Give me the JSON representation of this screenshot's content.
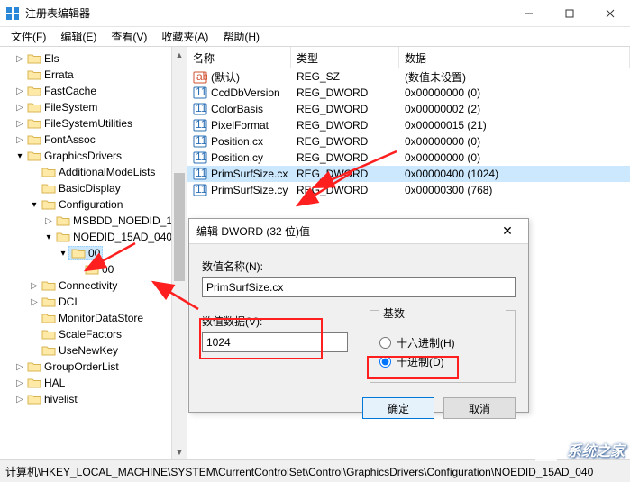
{
  "window": {
    "title": "注册表编辑器"
  },
  "menubar": {
    "file": "文件(F)",
    "edit": "编辑(E)",
    "view": "查看(V)",
    "favorites": "收藏夹(A)",
    "help": "帮助(H)"
  },
  "tree": {
    "items": [
      {
        "indent": 1,
        "caret": "closed",
        "label": "Els"
      },
      {
        "indent": 1,
        "caret": "none",
        "label": "Errata"
      },
      {
        "indent": 1,
        "caret": "closed",
        "label": "FastCache"
      },
      {
        "indent": 1,
        "caret": "closed",
        "label": "FileSystem"
      },
      {
        "indent": 1,
        "caret": "closed",
        "label": "FileSystemUtilities"
      },
      {
        "indent": 1,
        "caret": "closed",
        "label": "FontAssoc"
      },
      {
        "indent": 1,
        "caret": "open",
        "label": "GraphicsDrivers"
      },
      {
        "indent": 2,
        "caret": "none",
        "label": "AdditionalModeLists"
      },
      {
        "indent": 2,
        "caret": "none",
        "label": "BasicDisplay"
      },
      {
        "indent": 2,
        "caret": "open",
        "label": "Configuration"
      },
      {
        "indent": 3,
        "caret": "closed",
        "label": "MSBDD_NOEDID_1"
      },
      {
        "indent": 3,
        "caret": "open",
        "label": "NOEDID_15AD_040"
      },
      {
        "indent": 4,
        "caret": "open",
        "label": "00",
        "selected": true
      },
      {
        "indent": 5,
        "caret": "none",
        "label": "00"
      },
      {
        "indent": 2,
        "caret": "closed",
        "label": "Connectivity"
      },
      {
        "indent": 2,
        "caret": "closed",
        "label": "DCI"
      },
      {
        "indent": 2,
        "caret": "none",
        "label": "MonitorDataStore"
      },
      {
        "indent": 2,
        "caret": "none",
        "label": "ScaleFactors"
      },
      {
        "indent": 2,
        "caret": "none",
        "label": "UseNewKey"
      },
      {
        "indent": 1,
        "caret": "closed",
        "label": "GroupOrderList"
      },
      {
        "indent": 1,
        "caret": "closed",
        "label": "HAL"
      },
      {
        "indent": 1,
        "caret": "closed",
        "label": "hivelist"
      }
    ]
  },
  "list": {
    "headers": {
      "name": "名称",
      "type": "类型",
      "data": "数据"
    },
    "rows": [
      {
        "icon": "string",
        "name": "(默认)",
        "type": "REG_SZ",
        "data": "(数值未设置)"
      },
      {
        "icon": "dword",
        "name": "CcdDbVersion",
        "type": "REG_DWORD",
        "data": "0x00000000 (0)"
      },
      {
        "icon": "dword",
        "name": "ColorBasis",
        "type": "REG_DWORD",
        "data": "0x00000002 (2)"
      },
      {
        "icon": "dword",
        "name": "PixelFormat",
        "type": "REG_DWORD",
        "data": "0x00000015 (21)"
      },
      {
        "icon": "dword",
        "name": "Position.cx",
        "type": "REG_DWORD",
        "data": "0x00000000 (0)"
      },
      {
        "icon": "dword",
        "name": "Position.cy",
        "type": "REG_DWORD",
        "data": "0x00000000 (0)"
      },
      {
        "icon": "dword",
        "name": "PrimSurfSize.cx",
        "type": "REG_DWORD",
        "data": "0x00000400 (1024)",
        "selected": true
      },
      {
        "icon": "dword",
        "name": "PrimSurfSize.cy",
        "type": "REG_DWORD",
        "data": "0x00000300 (768)"
      }
    ]
  },
  "dialog": {
    "title": "编辑 DWORD (32 位)值",
    "name_label": "数值名称(N):",
    "name_value": "PrimSurfSize.cx",
    "data_label": "数值数据(V):",
    "data_value": "1024",
    "base_legend": "基数",
    "hex_label": "十六进制(H)",
    "dec_label": "十进制(D)",
    "ok": "确定",
    "cancel": "取消"
  },
  "statusbar": {
    "path": "计算机\\HKEY_LOCAL_MACHINE\\SYSTEM\\CurrentControlSet\\Control\\GraphicsDrivers\\Configuration\\NOEDID_15AD_040"
  },
  "watermark": {
    "text": "系统之家"
  }
}
